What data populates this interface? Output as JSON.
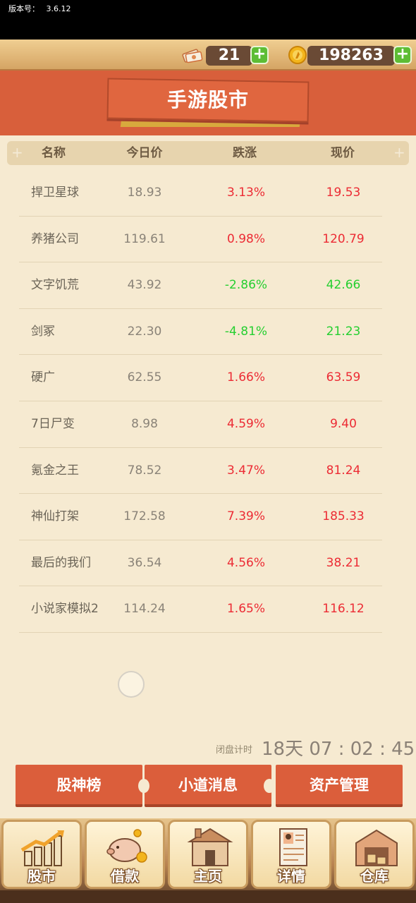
{
  "status": {
    "version_label": "版本号：",
    "version": "3.6.12"
  },
  "currency": {
    "tickets": "21",
    "coins": "198263",
    "tickets_icon": "ticket-icon",
    "coins_icon": "gold-coin-icon"
  },
  "title": "手游股市",
  "table": {
    "headers": [
      "名称",
      "今日价",
      "跌涨",
      "现价"
    ],
    "rows": [
      {
        "name": "捍卫星球",
        "today": "18.93",
        "change": "3.13%",
        "now": "19.53",
        "trend": "up"
      },
      {
        "name": "养猪公司",
        "today": "119.61",
        "change": "0.98%",
        "now": "120.79",
        "trend": "up"
      },
      {
        "name": "文字饥荒",
        "today": "43.92",
        "change": "-2.86%",
        "now": "42.66",
        "trend": "down"
      },
      {
        "name": "剑冢",
        "today": "22.30",
        "change": "-4.81%",
        "now": "21.23",
        "trend": "down"
      },
      {
        "name": "硬广",
        "today": "62.55",
        "change": "1.66%",
        "now": "63.59",
        "trend": "up"
      },
      {
        "name": "7日尸变",
        "today": "8.98",
        "change": "4.59%",
        "now": "9.40",
        "trend": "up"
      },
      {
        "name": "氪金之王",
        "today": "78.52",
        "change": "3.47%",
        "now": "81.24",
        "trend": "up"
      },
      {
        "name": "神仙打架",
        "today": "172.58",
        "change": "7.39%",
        "now": "185.33",
        "trend": "up"
      },
      {
        "name": "最后的我们",
        "today": "36.54",
        "change": "4.56%",
        "now": "38.21",
        "trend": "up"
      },
      {
        "name": "小说家模拟2",
        "today": "114.24",
        "change": "1.65%",
        "now": "116.12",
        "trend": "up"
      }
    ]
  },
  "countdown": {
    "label": "闭盘计时",
    "value": "18天 07 : 02 : 45"
  },
  "actions": [
    "股神榜",
    "小道消息",
    "资产管理"
  ],
  "nav": [
    {
      "label": "股市",
      "icon": "stock-chart-icon"
    },
    {
      "label": "借款",
      "icon": "piggy-bank-icon"
    },
    {
      "label": "主页",
      "icon": "house-icon"
    },
    {
      "label": "详情",
      "icon": "resume-icon"
    },
    {
      "label": "仓库",
      "icon": "warehouse-icon"
    }
  ],
  "colors": {
    "up": "#ec2b34",
    "down": "#25cf30",
    "accent": "#d85f3b"
  }
}
